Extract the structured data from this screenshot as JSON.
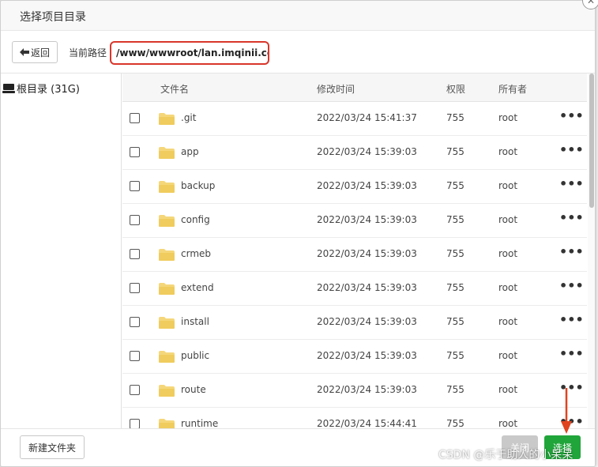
{
  "dialog": {
    "title": "选择项目目录"
  },
  "pathbar": {
    "back_label": "返回",
    "path_label": "当前路径",
    "path_value": "/www/wwwroot/lan.imqinii.com"
  },
  "sidebar": {
    "items": [
      {
        "label": "根目录 (31G)"
      }
    ]
  },
  "table": {
    "headers": {
      "name": "文件名",
      "mtime": "修改时间",
      "perm": "权限",
      "owner": "所有者"
    },
    "rows": [
      {
        "name": ".git",
        "mtime": "2022/03/24 15:41:37",
        "perm": "755",
        "owner": "root",
        "more": "•••"
      },
      {
        "name": "app",
        "mtime": "2022/03/24 15:39:03",
        "perm": "755",
        "owner": "root",
        "more": "•••"
      },
      {
        "name": "backup",
        "mtime": "2022/03/24 15:39:03",
        "perm": "755",
        "owner": "root",
        "more": "•••"
      },
      {
        "name": "config",
        "mtime": "2022/03/24 15:39:03",
        "perm": "755",
        "owner": "root",
        "more": "•••"
      },
      {
        "name": "crmeb",
        "mtime": "2022/03/24 15:39:03",
        "perm": "755",
        "owner": "root",
        "more": "•••"
      },
      {
        "name": "extend",
        "mtime": "2022/03/24 15:39:03",
        "perm": "755",
        "owner": "root",
        "more": "•••"
      },
      {
        "name": "install",
        "mtime": "2022/03/24 15:39:03",
        "perm": "755",
        "owner": "root",
        "more": "•••"
      },
      {
        "name": "public",
        "mtime": "2022/03/24 15:39:03",
        "perm": "755",
        "owner": "root",
        "more": "•••"
      },
      {
        "name": "route",
        "mtime": "2022/03/24 15:39:03",
        "perm": "755",
        "owner": "root",
        "more": "•••"
      },
      {
        "name": "runtime",
        "mtime": "2022/03/24 15:44:41",
        "perm": "755",
        "owner": "root",
        "more": "•••"
      }
    ]
  },
  "footer": {
    "new_folder_label": "新建文件夹",
    "close_label": "关闭",
    "select_label": "选择"
  },
  "watermark": "CSDN @乐于助人的小呆呆",
  "colors": {
    "highlight_border": "#d9362b",
    "select_button": "#20a53a",
    "close_button": "#c9c9c9",
    "folder": "#f5d77a"
  },
  "icons": {
    "back": "arrow-left-icon",
    "drive": "drive-icon",
    "folder": "folder-icon",
    "more": "more-dots-icon",
    "close": "close-icon"
  }
}
